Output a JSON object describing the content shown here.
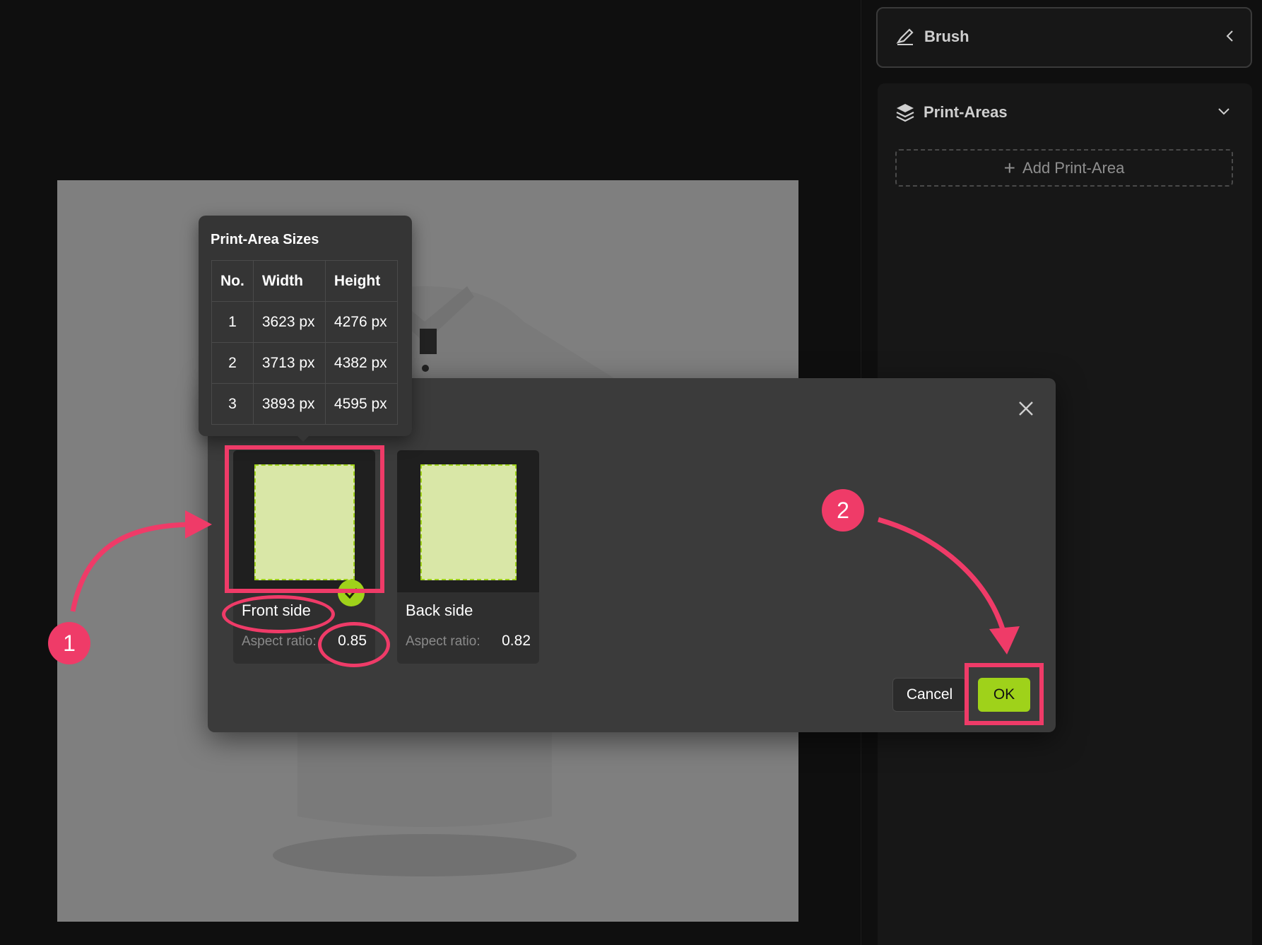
{
  "sidebar": {
    "brush": {
      "title": "Brush",
      "icon": "brush-icon"
    },
    "print_areas": {
      "title": "Print-Areas",
      "icon": "layers-icon",
      "add_label": "Add Print-Area"
    }
  },
  "tooltip": {
    "title": "Print-Area Sizes",
    "columns": [
      "No.",
      "Width",
      "Height"
    ],
    "rows": [
      [
        "1",
        "3623 px",
        "4276 px"
      ],
      [
        "2",
        "3713 px",
        "4382 px"
      ],
      [
        "3",
        "3893 px",
        "4595 px"
      ]
    ]
  },
  "dialog": {
    "cards": [
      {
        "name": "Front side",
        "ratio_label": "Aspect ratio:",
        "ratio_value": "0.85",
        "selected": true
      },
      {
        "name": "Back side",
        "ratio_label": "Aspect ratio:",
        "ratio_value": "0.82",
        "selected": false
      }
    ],
    "cancel_label": "Cancel",
    "ok_label": "OK"
  },
  "annotations": {
    "step1": "1",
    "step2": "2"
  },
  "colors": {
    "accent": "#9fd21a",
    "annotation": "#ef3b68",
    "dialog_bg": "#3b3b3b",
    "page_bg": "#0f0f0f"
  }
}
